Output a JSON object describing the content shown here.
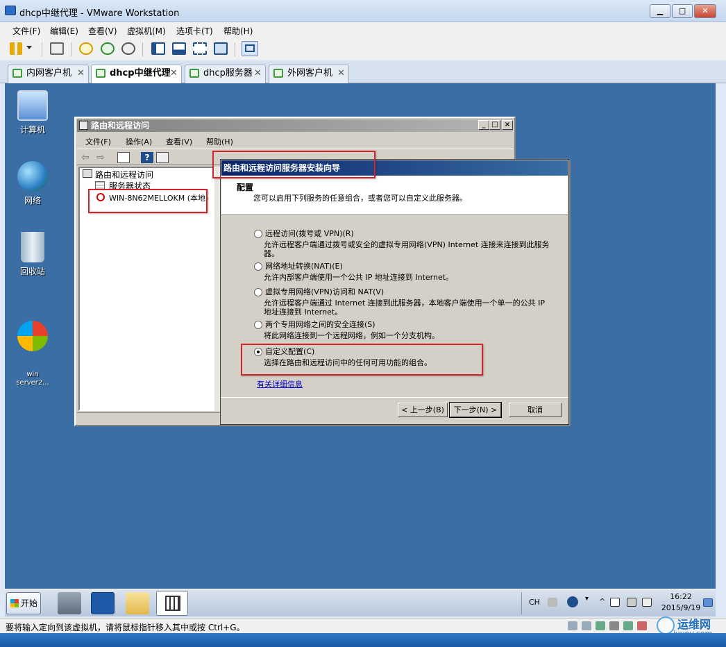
{
  "window": {
    "title": "dhcp中继代理 - VMware Workstation",
    "min": "▁",
    "max": "□",
    "close": "✕"
  },
  "menu": [
    "文件(F)",
    "编辑(E)",
    "查看(V)",
    "虚拟机(M)",
    "选项卡(T)",
    "帮助(H)"
  ],
  "tabs": [
    {
      "label": "内网客户机",
      "active": false
    },
    {
      "label": "dhcp中继代理",
      "active": true
    },
    {
      "label": "dhcp服务器",
      "active": false
    },
    {
      "label": "外网客户机",
      "active": false
    }
  ],
  "tab_close": "✕",
  "desktop_icons": [
    {
      "label": "计算机",
      "icon": "computer-icon"
    },
    {
      "label": "网络",
      "icon": "network-icon"
    },
    {
      "label": "回收站",
      "icon": "recycle-bin-icon"
    },
    {
      "label": "win\nserver2...",
      "icon": "windows-icon"
    }
  ],
  "mmc": {
    "title": "路由和远程访问",
    "menu": [
      "文件(F)",
      "操作(A)",
      "查看(V)",
      "帮助(H)"
    ],
    "tree": {
      "root": "路由和远程访问",
      "items": [
        "服务器状态",
        "WIN-8N62MELLOKM (本地)"
      ]
    }
  },
  "wizard": {
    "title": "路由和远程访问服务器安装向导",
    "heading": "配置",
    "subheading": "您可以启用下列服务的任意组合，或者您可以自定义此服务器。",
    "options": [
      {
        "label": "远程访问(拨号或 VPN)(R)",
        "desc": "允许远程客户端通过拨号或安全的虚拟专用网络(VPN) Internet 连接来连接到此服务器。",
        "checked": false
      },
      {
        "label": "网络地址转换(NAT)(E)",
        "desc": "允许内部客户端使用一个公共 IP 地址连接到 Internet。",
        "checked": false
      },
      {
        "label": "虚拟专用网络(VPN)访问和 NAT(V)",
        "desc": "允许远程客户端通过 Internet 连接到此服务器，本地客户端使用一个单一的公共 IP 地址连接到 Internet。",
        "checked": false
      },
      {
        "label": "两个专用网络之间的安全连接(S)",
        "desc": "将此网络连接到一个远程网络，例如一个分支机构。",
        "checked": false
      },
      {
        "label": "自定义配置(C)",
        "desc": "选择在路由和远程访问中的任何可用功能的组合。",
        "checked": true
      }
    ],
    "link": "有关详细信息",
    "buttons": {
      "back": "< 上一步(B)",
      "next": "下一步(N) >",
      "cancel": "取消"
    }
  },
  "taskbar": {
    "start": "开始",
    "lang": "CH",
    "time": "16:22",
    "date": "2015/9/19"
  },
  "status": "要将输入定向到该虚拟机，请将鼠标指针移入其中或按 Ctrl+G。",
  "watermark": {
    "name": "运维网",
    "url": "iyunv.com"
  }
}
